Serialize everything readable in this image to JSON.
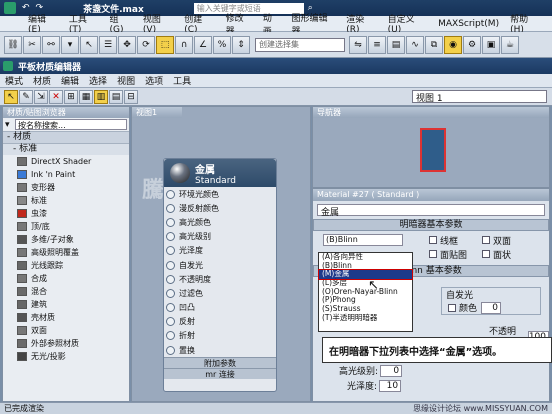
{
  "app": {
    "title": "茶盏文件.max",
    "search_placeholder": "输入关键字或短语"
  },
  "menu": [
    "编辑(E)",
    "工具(T)",
    "组(G)",
    "视图(V)",
    "创建(C)",
    "修改器",
    "动画",
    "图形编辑器",
    "渲染(R)",
    "自定义(U)",
    "MAXScript(M)",
    "帮助(H)"
  ],
  "toolbar": {
    "selection_set_placeholder": "创建选择集"
  },
  "slate": {
    "title": "平板材质编辑器",
    "menu": [
      "模式",
      "材质",
      "编辑",
      "选择",
      "视图",
      "选项",
      "工具"
    ],
    "view_dropdown": "视图 1"
  },
  "browser": {
    "title": "材质/贴图浏览器",
    "search": "按名称搜索...",
    "category": "- 材质",
    "subcategory": "- 标准",
    "items": [
      {
        "label": "DirectX Shader",
        "color": "#6f6f6f"
      },
      {
        "label": "Ink 'n Paint",
        "color": "#3a7ad6"
      },
      {
        "label": "变形器",
        "color": "#777"
      },
      {
        "label": "标准",
        "color": "#888"
      },
      {
        "label": "虫漆",
        "color": "#c0281c"
      },
      {
        "label": "顶/底",
        "color": "#777"
      },
      {
        "label": "多维/子对象",
        "color": "#555"
      },
      {
        "label": "高级照明覆盖",
        "color": "#777"
      },
      {
        "label": "光线跟踪",
        "color": "#666"
      },
      {
        "label": "合成",
        "color": "#777"
      },
      {
        "label": "混合",
        "color": "#6a6a6a"
      },
      {
        "label": "建筑",
        "color": "#666"
      },
      {
        "label": "壳材质",
        "color": "#555"
      },
      {
        "label": "双面",
        "color": "#777"
      },
      {
        "label": "外部参照材质",
        "color": "#6b6b6b"
      },
      {
        "label": "无光/投影",
        "color": "#444"
      }
    ]
  },
  "view": {
    "tab": "视图1",
    "watermark": "騰龍視覺"
  },
  "node": {
    "name": "金属",
    "type": "Standard",
    "slots": [
      "环境光颜色",
      "漫反射颜色",
      "高光颜色",
      "高光级别",
      "光泽度",
      "自发光",
      "不透明度",
      "过滤色",
      "凹凸",
      "反射",
      "折射",
      "置换"
    ],
    "footer1": "附加参数",
    "footer2": "mr 连接"
  },
  "navigator": {
    "title": "导航器"
  },
  "props": {
    "header": "Material #27  ( Standard )",
    "name": "金属",
    "rollout1": "明暗器基本参数",
    "shader": "(B)Blinn",
    "options": [
      "线框",
      "双面",
      "面贴图",
      "面状"
    ],
    "rollout2": "Blinn 基本参数",
    "self_illum": "自发光",
    "color_label": "颜色",
    "color_value": "0",
    "opacity_label": "不透明度:",
    "opacity_value": "100",
    "spec_label": "高光级别:",
    "spec_value": "0",
    "gloss_label": "光泽度:",
    "gloss_value": "10"
  },
  "dropdown": [
    "(A)各向异性",
    "(B)Blinn",
    "(M)金属",
    "(L)多层",
    "(O)Oren-Nayar-Blinn",
    "(P)Phong",
    "(S)Strauss",
    "(T)半透明明暗器"
  ],
  "tip": "在明暗器下拉列表中选择“金属”选项。",
  "status": {
    "left": "已完成渲染",
    "watermark": "思缘设计论坛 www.MISSYUAN.COM"
  }
}
